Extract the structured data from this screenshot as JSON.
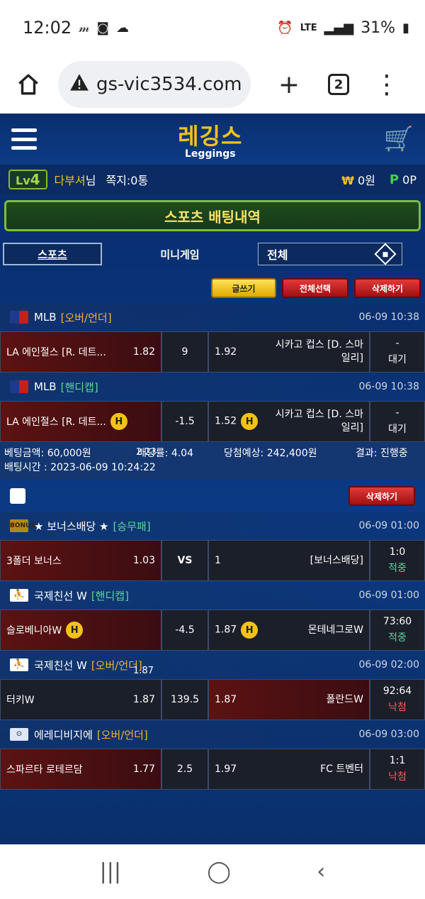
{
  "status": {
    "time": "12:02",
    "battery": "31%",
    "net": "LTE"
  },
  "browser": {
    "url": "gs-vic3534.com",
    "tabs": "2"
  },
  "site": {
    "logo_ko": "레깅스",
    "logo_en": "Leggings"
  },
  "user": {
    "level_prefix": "Lv",
    "level": "4",
    "name": "다부셔",
    "suffix": "님",
    "note": "쪽지:0통",
    "won_symbol": "₩",
    "won": "0원",
    "p_symbol": "P",
    "point": "0P"
  },
  "title": "스포츠 배팅내역",
  "tabs": {
    "sports": "스포츠",
    "mini": "미니게임",
    "select": "전체"
  },
  "buttons": {
    "write": "글쓰기",
    "select_all": "전체선택",
    "delete": "삭제하기"
  },
  "bet1": {
    "games": [
      {
        "league": "MLB",
        "type": "[오버/언더]",
        "date": "06-09 10:38",
        "home": "LA 에인절스 [R. 데트...",
        "home_odds": "1.82",
        "mid": "9",
        "away_odds": "1.92",
        "away": "시카고 컵스 [D. 스마일리]",
        "res_top": "-",
        "res_bottom": "대기"
      },
      {
        "league": "MLB",
        "type": "[핸디캡]",
        "date": "06-09 10:38",
        "home": "LA 에인절스 [R. 데트...",
        "home_badge": "H",
        "mid": "-1.5",
        "away_odds": "1.52",
        "away_badge": "H",
        "away": "시카고 컵스 [D. 스마일리]",
        "res_top": "-",
        "res_bottom": "대기"
      }
    ],
    "summary": {
      "amount_label": "베팅금액:",
      "amount": "60,000원",
      "rate_label": "배당률:",
      "rate": "4.04",
      "expect_label": "당첨예상:",
      "expect": "242,400원",
      "result_label": "결과:",
      "result": "진행중",
      "time_label": "배팅시간 :",
      "time": "2023-06-09 10:24:22",
      "overlay_num": "2.23"
    }
  },
  "bet2": {
    "delete": "삭제하기",
    "games": [
      {
        "league": "★ 보너스배당 ★",
        "type": "[승무패]",
        "date": "06-09 01:00",
        "home": "3폴더 보너스",
        "home_odds": "1.03",
        "mid": "VS",
        "away_odds": "1",
        "away": "[보너스배당]",
        "res_top": "1:0",
        "res_bottom": "적중"
      },
      {
        "league": "국제친선 W",
        "type": "[핸디캡]",
        "date": "06-09 01:00",
        "home": "슬로베니아W",
        "home_badge": "H",
        "mid": "-4.5",
        "away_odds": "1.87",
        "away_badge": "H",
        "away": "몬테네그로W",
        "res_top": "73:60",
        "res_bottom": "적중"
      },
      {
        "league": "국제친선 W",
        "type": "[오버/언더]",
        "date": "06-09 02:00",
        "overlay": "1.87",
        "home": "터키W",
        "home_odds": "1.87",
        "mid": "139.5",
        "away_odds": "1.87",
        "away": "폴란드W",
        "res_top": "92:64",
        "res_bottom": "낙첨"
      },
      {
        "league": "에레디비지에",
        "type": "[오버/언더]",
        "date": "06-09 03:00",
        "home": "스파르타 로테르담",
        "home_odds": "1.77",
        "mid": "2.5",
        "away_odds": "1.97",
        "away": "FC 트벤터",
        "res_top": "1:1",
        "res_bottom": "낙첨"
      }
    ]
  }
}
